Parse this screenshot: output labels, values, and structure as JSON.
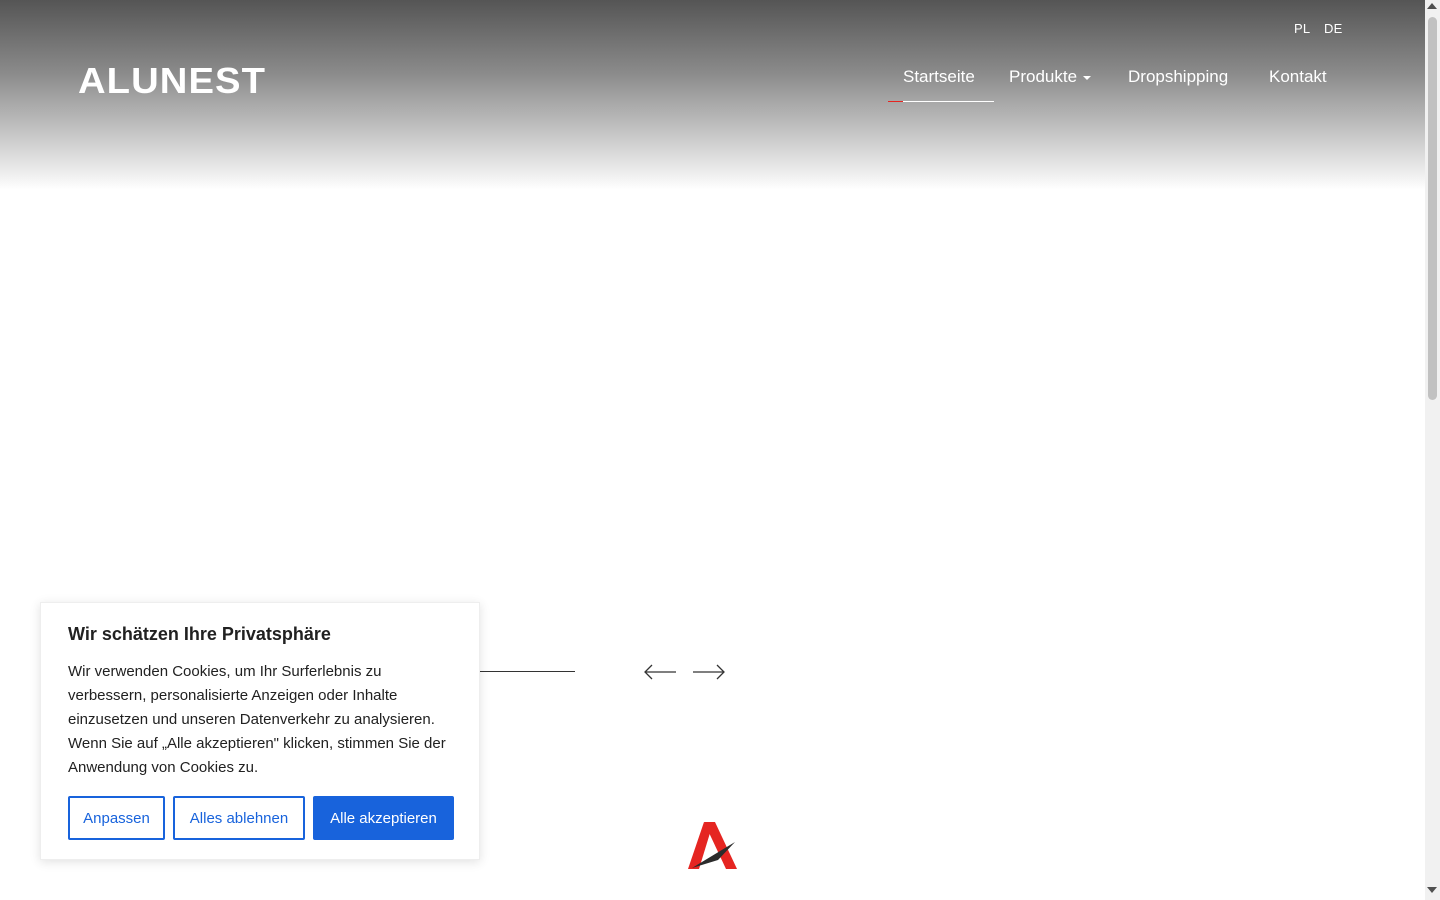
{
  "header": {
    "logo_text": "ALUNEST",
    "languages": [
      "PL",
      "DE"
    ],
    "nav": {
      "items": [
        {
          "label": "Startseite",
          "active": true
        },
        {
          "label": "Produkte",
          "dropdown": true
        },
        {
          "label": "Dropshipping"
        },
        {
          "label": "Kontakt"
        }
      ]
    }
  },
  "slider": {
    "prev_icon": "arrow-left-icon",
    "next_icon": "arrow-right-icon"
  },
  "cookie_banner": {
    "title": "Wir schätzen Ihre Privatsphäre",
    "text": "Wir verwenden Cookies, um Ihr Surferlebnis zu verbessern, personalisierte Anzeigen oder Inhalte einzusetzen und unseren Datenverkehr zu analysieren. Wenn Sie auf „Alle akzeptieren\" klicken, stimmen Sie der Anwendung von Cookies zu.",
    "buttons": {
      "customize": "Anpassen",
      "reject": "Alles ablehnen",
      "accept": "Alle akzeptieren"
    }
  },
  "colors": {
    "accent_blue": "#1863dc",
    "brand_red": "#e52521",
    "text_dark": "#212121"
  }
}
